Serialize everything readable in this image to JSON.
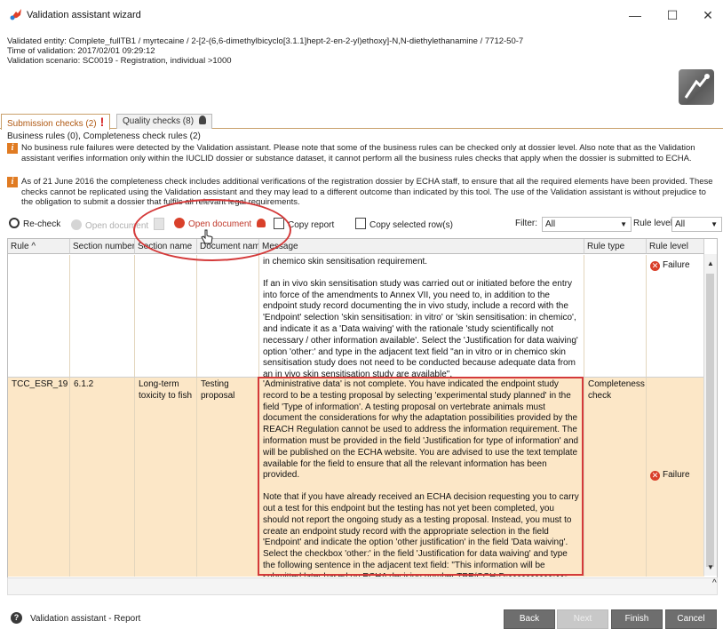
{
  "window": {
    "title": "Validation assistant wizard",
    "minimize": "—",
    "maximize": "☐",
    "close": "✕"
  },
  "info": {
    "entity": "Validated entity: Complete_fullTB1 / myrtecaine / 2-[2-(6,6-dimethylbicyclo[3.1.1]hept-2-en-2-yl)ethoxy]-N,N-diethylethanamine / 7712-50-7",
    "time": "Time of validation: 2017/02/01 09:29:12",
    "scenario": "Validation scenario: SC0019 - Registration, individual >1000"
  },
  "tabs": [
    {
      "label": "Submission checks (2)",
      "marker": "!"
    },
    {
      "label": "Quality checks (8)",
      "marker": "🏅"
    }
  ],
  "summary": "Business rules (0), Completeness check rules (2)",
  "notes": [
    "No business rule failures were detected by the Validation assistant. Please note that some of the business rules can be checked only at dossier level. Also note that as the Validation assistant verifies information only within the IUCLID dossier or substance dataset, it cannot perform all the business rules checks that apply when the dossier is submitted to ECHA.",
    "As of 21 June 2016 the completeness check includes additional verifications of the registration dossier by ECHA staff, to ensure that all the required elements have been provided. These checks cannot be replicated using the Validation assistant and they may lead to a different outcome than indicated by this tool. The use of the Validation assistant is without prejudice to the obligation to submit a dossier that fulfils all relevant legal requirements."
  ],
  "toolbar": {
    "recheck": "Re-check",
    "open_doc_disabled": "Open document",
    "open_doc": "Open document",
    "copy_report": "Copy report",
    "copy_rows": "Copy selected row(s)",
    "filter_label": "Filter:",
    "filter_value": "All",
    "rule_level_label": "Rule level:",
    "rule_level_value": "All"
  },
  "table": {
    "columns": [
      "Rule ^",
      "Section number",
      "Section name",
      "Document name",
      "Message",
      "Rule type",
      "Rule level"
    ],
    "rows": [
      {
        "rule": "",
        "section_number": "",
        "section_name": "",
        "document_name": "",
        "message_p1": "in chemico skin sensitisation requirement.",
        "message_p2": "If an in vivo skin sensitisation study was carried out or initiated before the entry into force of the amendments to Annex VII, you need to, in addition to the endpoint study record documenting the in vivo study, include a record with the 'Endpoint' selection 'skin sensitisation: in vitro' or 'skin sensitisation: in chemico', and indicate it as a 'Data waiving' with the rationale 'study scientifically not necessary / other information available'. Select the 'Justification for data waiving' option 'other:' and type in the adjacent text field \"an in vitro or in chemico skin sensitisation study does not need to be conducted because adequate data from an in vivo skin sensitisation study are available\".",
        "rule_type": "",
        "rule_level": "Failure"
      },
      {
        "rule": "TCC_ESR_19",
        "section_number": "6.1.2",
        "section_name": "Long-term toxicity to fish",
        "document_name": "Testing proposal",
        "message_p1": "'Administrative data' is not complete. You have indicated the endpoint study record to be a testing proposal by selecting 'experimental study planned' in the field 'Type of information'. A testing proposal on vertebrate animals must document the considerations for why the adaptation possibilities provided by the REACH Regulation cannot be used to address the information requirement. The information must be provided in the field 'Justification for type of information' and will be published on the ECHA website. You are advised to use the text template available for the field to ensure that all the relevant information has been provided.",
        "message_p2": "Note that if you have already received an ECHA decision requesting you to carry out a test for this endpoint but the testing has not yet been completed, you should not report the ongoing study as a testing proposal. Instead, you must to create an endpoint study record with the appropriate selection in the field 'Endpoint' and indicate the option 'other justification' in the field 'Data waiving'. Select the checkbox 'other:' in the field 'Justification for data waiving' and type the following sentence in the adjacent text field: \"This information will be submitted later based on ECHA decision number TPE/CCH-D-xxxxxxxxxx-xx-xx\".",
        "rule_type": "Completeness check",
        "rule_level": "Failure"
      }
    ]
  },
  "footer": {
    "help": "?",
    "label": "Validation assistant - Report",
    "back": "Back",
    "next": "Next",
    "finish": "Finish",
    "cancel": "Cancel"
  }
}
